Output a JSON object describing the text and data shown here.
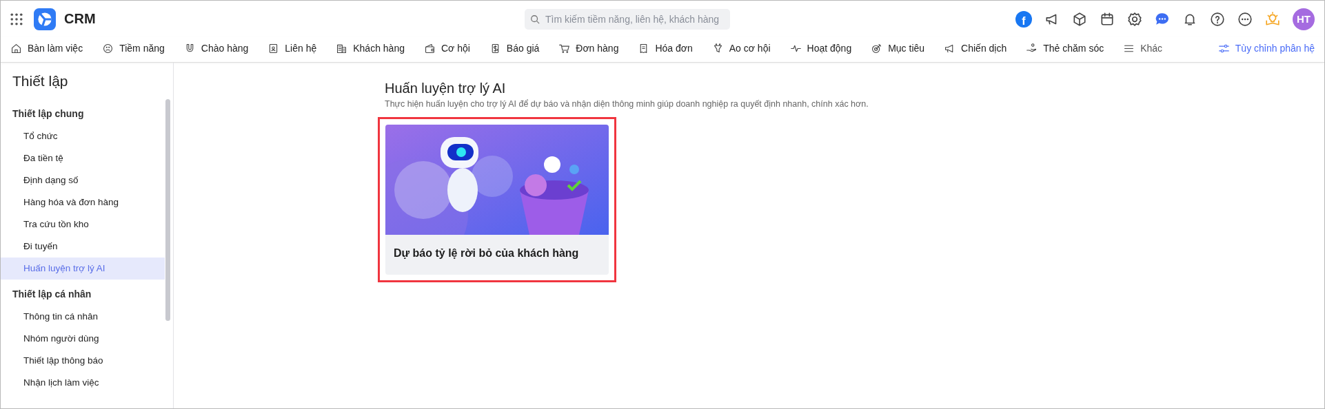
{
  "app": {
    "name": "CRM"
  },
  "search": {
    "placeholder": "Tìm kiếm tiềm năng, liên hệ, khách hàng"
  },
  "header_actions": {
    "facebook_mark": "f",
    "avatar": "HT"
  },
  "nav": {
    "items": [
      {
        "label": "Bàn làm việc"
      },
      {
        "label": "Tiềm năng"
      },
      {
        "label": "Chào hàng"
      },
      {
        "label": "Liên hệ"
      },
      {
        "label": "Khách hàng"
      },
      {
        "label": "Cơ hội"
      },
      {
        "label": "Báo giá"
      },
      {
        "label": "Đơn hàng"
      },
      {
        "label": "Hóa đơn"
      },
      {
        "label": "Ao cơ hội"
      },
      {
        "label": "Hoạt động"
      },
      {
        "label": "Mục tiêu"
      },
      {
        "label": "Chiến dịch"
      },
      {
        "label": "Thẻ chăm sóc"
      }
    ],
    "more": "Khác",
    "customize": "Tùy chỉnh phân hệ"
  },
  "sidebar": {
    "title": "Thiết lập",
    "groups": [
      {
        "heading": "Thiết lập chung",
        "items": [
          {
            "label": "Tổ chức",
            "selected": false
          },
          {
            "label": "Đa tiền tệ",
            "selected": false
          },
          {
            "label": "Định dạng số",
            "selected": false
          },
          {
            "label": "Hàng hóa và đơn hàng",
            "selected": false
          },
          {
            "label": "Tra cứu tồn kho",
            "selected": false
          },
          {
            "label": "Đi tuyến",
            "selected": false
          },
          {
            "label": "Huấn luyện trợ lý AI",
            "selected": true
          }
        ]
      },
      {
        "heading": "Thiết lập cá nhân",
        "items": [
          {
            "label": "Thông tin cá nhân",
            "selected": false
          },
          {
            "label": "Nhóm người dùng",
            "selected": false
          },
          {
            "label": "Thiết lập thông báo",
            "selected": false
          },
          {
            "label": "Nhận lịch làm việc",
            "selected": false
          }
        ]
      }
    ]
  },
  "content": {
    "title": "Huấn luyện trợ lý AI",
    "description": "Thực hiện huấn luyện cho trợ lý AI để dự báo và nhận diện thông minh giúp doanh nghiệp ra quyết định nhanh, chính xác hơn.",
    "cards": [
      {
        "title": "Dự báo tỷ lệ rời bỏ của khách hàng",
        "highlighted": true
      }
    ]
  }
}
